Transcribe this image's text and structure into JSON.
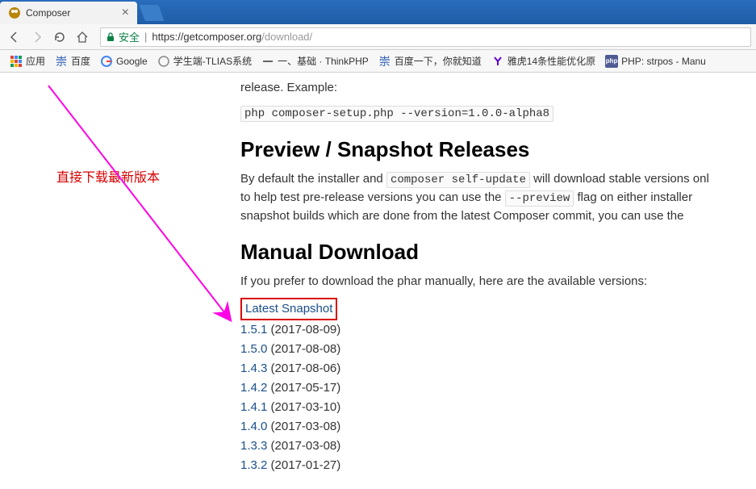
{
  "tab": {
    "title": "Composer"
  },
  "url": {
    "secure_label": "安全",
    "base": "https://getcomposer.org",
    "path": "/download/"
  },
  "bookmarks": {
    "apps": "应用",
    "items": [
      {
        "label": "百度",
        "icon": "baidu"
      },
      {
        "label": "Google",
        "icon": "google"
      },
      {
        "label": "学生端-TLIAS系统",
        "icon": "generic"
      },
      {
        "label": "一、基础 · ThinkPHP",
        "icon": "line"
      },
      {
        "label": "百度一下，你就知道",
        "icon": "baidu"
      },
      {
        "label": "雅虎14条性能优化原",
        "icon": "yahoo"
      },
      {
        "label": "PHP: strpos - Manu",
        "icon": "php"
      }
    ]
  },
  "content": {
    "release_example_intro": "release. Example:",
    "code_example": "php composer-setup.php --version=1.0.0-alpha8",
    "heading_preview": "Preview / Snapshot Releases",
    "preview_p1_a": "By default the installer and ",
    "preview_code1": "composer self-update",
    "preview_p1_b": " will download stable versions onl",
    "preview_p2_a": "to help test pre-release versions you can use the ",
    "preview_code2": "--preview",
    "preview_p2_b": " flag on either installer ",
    "preview_p3": "snapshot builds which are done from the latest Composer commit, you can use the",
    "heading_manual": "Manual Download",
    "manual_intro": "If you prefer to download the phar manually, here are the available versions:",
    "latest_snapshot": "Latest Snapshot",
    "versions": [
      {
        "ver": "1.5.1",
        "date": "(2017-08-09)"
      },
      {
        "ver": "1.5.0",
        "date": "(2017-08-08)"
      },
      {
        "ver": "1.4.3",
        "date": "(2017-08-06)"
      },
      {
        "ver": "1.4.2",
        "date": "(2017-05-17)"
      },
      {
        "ver": "1.4.1",
        "date": "(2017-03-10)"
      },
      {
        "ver": "1.4.0",
        "date": "(2017-03-08)"
      },
      {
        "ver": "1.3.3",
        "date": "(2017-03-08)"
      },
      {
        "ver": "1.3.2",
        "date": "(2017-01-27)"
      }
    ]
  },
  "annotation": "直接下载最新版本"
}
